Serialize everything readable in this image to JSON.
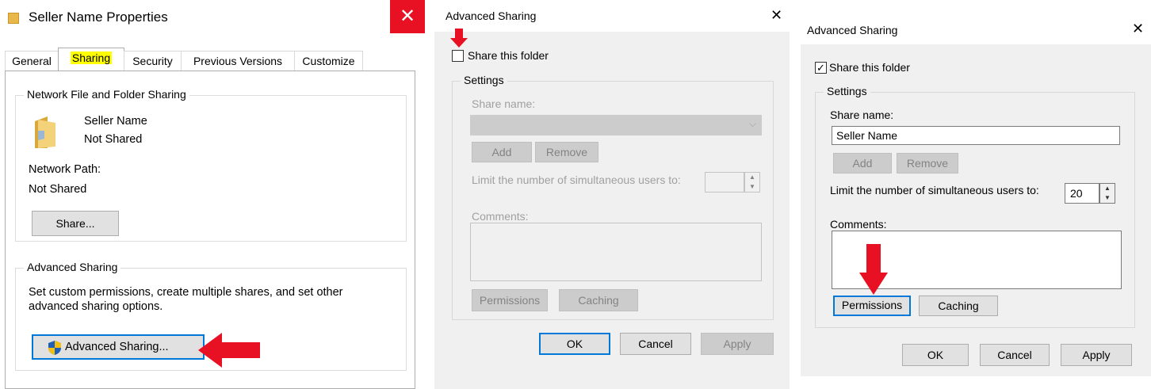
{
  "properties": {
    "title": "Seller Name Properties",
    "close_glyph": "✕",
    "tabs": [
      "General",
      "Sharing",
      "Security",
      "Previous Versions",
      "Customize"
    ],
    "network_group_label": "Network File and Folder Sharing",
    "folder_name": "Seller Name",
    "folder_status": "Not Shared",
    "network_path_label": "Network Path:",
    "network_path_value": "Not Shared",
    "share_button": "Share...",
    "advanced_group_label": "Advanced Sharing",
    "advanced_desc_line1": "Set custom permissions, create multiple shares, and set other",
    "advanced_desc_line2": "advanced sharing options.",
    "advanced_button": "Advanced Sharing...",
    "arrow_color": "#e81123"
  },
  "adv_unchecked": {
    "title": "Advanced Sharing",
    "close_glyph": "✕",
    "share_checkbox_label": "Share this folder",
    "share_checked": false,
    "settings_label": "Settings",
    "share_name_label": "Share name:",
    "share_name_value": "",
    "add_button": "Add",
    "remove_button": "Remove",
    "limit_label": "Limit the number of simultaneous users to:",
    "limit_value": "",
    "comments_label": "Comments:",
    "permissions_button": "Permissions",
    "caching_button": "Caching",
    "ok_button": "OK",
    "cancel_button": "Cancel",
    "apply_button": "Apply"
  },
  "adv_checked": {
    "title": "Advanced Sharing",
    "close_glyph": "✕",
    "share_checkbox_label": "Share this folder",
    "share_checked": true,
    "check_glyph": "✓",
    "settings_label": "Settings",
    "share_name_label": "Share name:",
    "share_name_value": "Seller Name",
    "add_button": "Add",
    "remove_button": "Remove",
    "limit_label": "Limit the number of simultaneous users to:",
    "limit_value": "20",
    "comments_label": "Comments:",
    "permissions_button": "Permissions",
    "caching_button": "Caching",
    "ok_button": "OK",
    "cancel_button": "Cancel",
    "apply_button": "Apply"
  }
}
